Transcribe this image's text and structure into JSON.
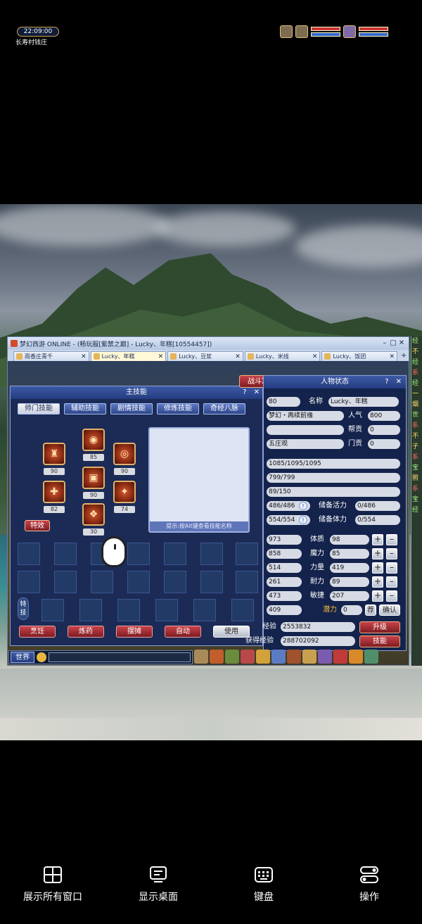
{
  "window": {
    "title": "梦幻西游 ONLINE - (畅玩服[紫禁之巅] - Lucky、年糕[10554457])",
    "tabs": [
      {
        "label": "雨香庄青千"
      },
      {
        "label": "Lucky、年糕"
      },
      {
        "label": "Lucky、豆浆"
      },
      {
        "label": "Lucky、米线"
      },
      {
        "label": "Lucky、饭团"
      }
    ]
  },
  "hud": {
    "clock": "22:09:00",
    "location": "长寿村钱庄"
  },
  "skill_panel": {
    "title": "主技能",
    "help": "?",
    "close": "✕",
    "tabs": [
      "师门技能",
      "辅助技能",
      "剧情技能",
      "修炼技能",
      "奇经八脉"
    ],
    "skills": [
      {
        "level": "85"
      },
      {
        "level": "90"
      },
      {
        "level": "90"
      },
      {
        "level": "90"
      },
      {
        "level": "82"
      },
      {
        "level": "74"
      },
      {
        "level": "30"
      }
    ],
    "special_button": "特效",
    "hint": "提示:按Alt键查看技能名称",
    "tech_label": "特技",
    "actions": [
      "烹饪",
      "炼药",
      "摆摊",
      "自动",
      "使用"
    ]
  },
  "char_panel": {
    "title": "人物状态",
    "battle_prep": "战斗准备",
    "help": "?",
    "close": "✕",
    "level": "80",
    "name_label": "名称",
    "name": "Lucky、年糕",
    "title_value": "梦幻・再续前缘",
    "popularity_label": "人气",
    "popularity": "800",
    "contribution_label": "帮贡",
    "contribution": "0",
    "sect": "五庄观",
    "sect_contribution_label": "门贡",
    "sect_contribution": "0",
    "hp": "1085/1095/1095",
    "mp": "799/799",
    "anger": "89/150",
    "vitality": "486/486",
    "reserve_vitality_label": "储备活力",
    "reserve_vitality": "0/486",
    "stamina": "554/554",
    "reserve_stamina_label": "储备体力",
    "reserve_stamina": "0/554",
    "attrs": [
      {
        "left": "973",
        "label": "体质",
        "value": "98"
      },
      {
        "left": "858",
        "label": "魔力",
        "value": "85"
      },
      {
        "left": "514",
        "label": "力量",
        "value": "419"
      },
      {
        "left": "261",
        "label": "耐力",
        "value": "89"
      },
      {
        "left": "473",
        "label": "敏捷",
        "value": "207"
      }
    ],
    "speed": "409",
    "potential_label": "潜力",
    "potential": "0",
    "recommend": "荐",
    "confirm": "确认",
    "exp_label": "经验",
    "exp": "2553832",
    "upgrade": "升级",
    "acquired_exp_label": "获得经验",
    "acquired_exp": "288702092",
    "skill_button": "技能"
  },
  "chat": {
    "world": "世界"
  },
  "side_strip": [
    "经",
    "不",
    "经",
    "系",
    "经",
    "一",
    "烟",
    "世",
    "系",
    "不",
    "子",
    "系",
    "宝",
    "照",
    "系",
    "宝",
    "经"
  ],
  "bottom_nav": [
    {
      "label": "展示所有窗口",
      "icon": "grid-windows-icon"
    },
    {
      "label": "显示桌面",
      "icon": "desktop-icon"
    },
    {
      "label": "键盘",
      "icon": "keyboard-icon"
    },
    {
      "label": "操作",
      "icon": "toggle-icon"
    }
  ],
  "colors": {
    "accent_red": "#c9424a",
    "panel_blue": "#1b2b56",
    "header_blue": "#3e5aa6"
  }
}
